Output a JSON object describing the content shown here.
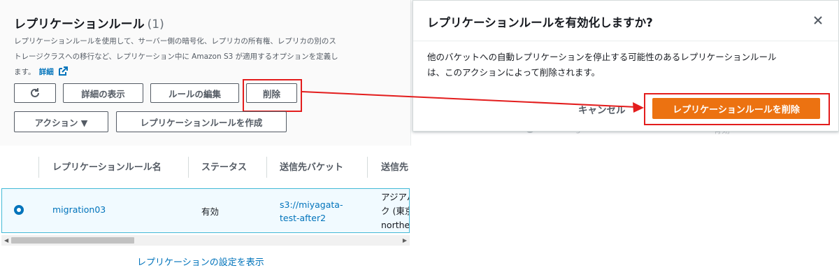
{
  "left": {
    "title": "レプリケーションルール",
    "count": "(1)",
    "description_line1": "レプリケーションルールを使用して、サーバー側の暗号化、レプリカの所有権、レプリカの別のス",
    "description_line2": "トレージクラスへの移行など、レプリケーション中に Amazon S3 が適用するオプションを定義し",
    "description_line3": "ます。",
    "detail_link": "詳細",
    "buttons": {
      "refresh_icon": "refresh-icon",
      "view_details": "詳細の表示",
      "edit_rule": "ルールの編集",
      "delete": "削除",
      "actions": "アクション ▼",
      "create_rule": "レプリケーションルールを作成"
    },
    "table": {
      "headers": [
        "レプリケーションルール名",
        "ステータス",
        "送信先バケット",
        "送信先"
      ],
      "row": {
        "name": "migration03",
        "status": "有効",
        "bucket_line1": "s3://miyagata-",
        "bucket_line2": "test-after2",
        "region_line1": "アジアパ",
        "region_line2": "ク (東京",
        "region_line3": "northe"
      }
    },
    "footer_link": "レプリケーションの設定を表示"
  },
  "ghost": {
    "row_name": "migration03",
    "row_status": "有効"
  },
  "modal": {
    "title": "レプリケーションルールを有効化しますか?",
    "body_line1": "他のバケットへの自動レプリケーションを停止する可能性のあるレプリケーションルール",
    "body_line2": "は、このアクションによって削除されます。",
    "cancel": "キャンセル",
    "confirm": "レプリケーションルールを削除"
  },
  "colors": {
    "primary": "#ec7211",
    "link": "#0073bb",
    "highlight": "#e31d1d"
  }
}
